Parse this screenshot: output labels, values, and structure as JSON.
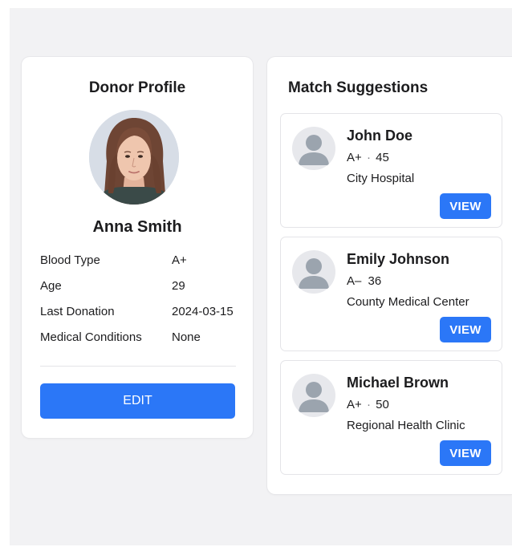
{
  "profile": {
    "title": "Donor Profile",
    "name": "Anna Smith",
    "fields": [
      {
        "label": "Blood Type",
        "value": "A+"
      },
      {
        "label": "Age",
        "value": "29"
      },
      {
        "label": "Last Donation",
        "value": "2024-03-15"
      },
      {
        "label": "Medical Conditions",
        "value": "None"
      }
    ],
    "edit_label": "EDIT"
  },
  "matches": {
    "title": "Match Suggestions",
    "items": [
      {
        "name": "John Doe",
        "blood_type": "A+",
        "separator": "·",
        "age": "45",
        "location": "City Hospital",
        "view_label": "VIEW"
      },
      {
        "name": "Emily Johnson",
        "blood_type": "A–",
        "separator": "",
        "age": "36",
        "location": "County Medical Center",
        "view_label": "VIEW"
      },
      {
        "name": "Michael Brown",
        "blood_type": "A+",
        "separator": "·",
        "age": "50",
        "location": "Regional Health Clinic",
        "view_label": "VIEW"
      }
    ]
  },
  "colors": {
    "accent": "#2b77f7",
    "background": "#f2f2f4",
    "card": "#ffffff",
    "avatar_placeholder": "#e7e8ec",
    "avatar_silhouette": "#9ba4ae"
  },
  "icons": {
    "avatar": "person-silhouette-icon"
  }
}
